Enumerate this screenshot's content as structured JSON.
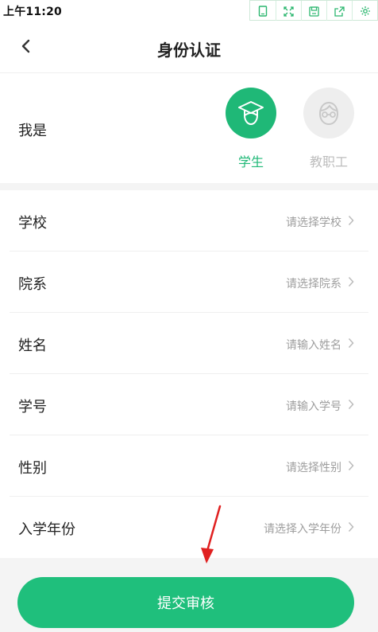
{
  "status_bar": {
    "time": "上午11:20",
    "icons": [
      "phone-frame-icon",
      "fullscreen-icon",
      "save-icon",
      "share-icon",
      "settings-icon"
    ]
  },
  "navbar": {
    "title": "身份认证",
    "back_icon": "chevron-left-icon"
  },
  "identity": {
    "label": "我是",
    "roles": [
      {
        "label": "学生",
        "icon": "graduation-cap-avatar-icon",
        "selected": true
      },
      {
        "label": "教职工",
        "icon": "teacher-avatar-icon",
        "selected": false
      }
    ]
  },
  "form": {
    "rows": [
      {
        "label": "学校",
        "placeholder": "请选择学校"
      },
      {
        "label": "院系",
        "placeholder": "请选择院系"
      },
      {
        "label": "姓名",
        "placeholder": "请输入姓名"
      },
      {
        "label": "学号",
        "placeholder": "请输入学号"
      },
      {
        "label": "性别",
        "placeholder": "请选择性别"
      },
      {
        "label": "入学年份",
        "placeholder": "请选择入学年份"
      }
    ]
  },
  "submit": {
    "label": "提交审核"
  },
  "colors": {
    "accent": "#1fb877",
    "button": "#1fbf7c",
    "placeholder": "#9e9e9e",
    "annotation": "#e02020"
  }
}
